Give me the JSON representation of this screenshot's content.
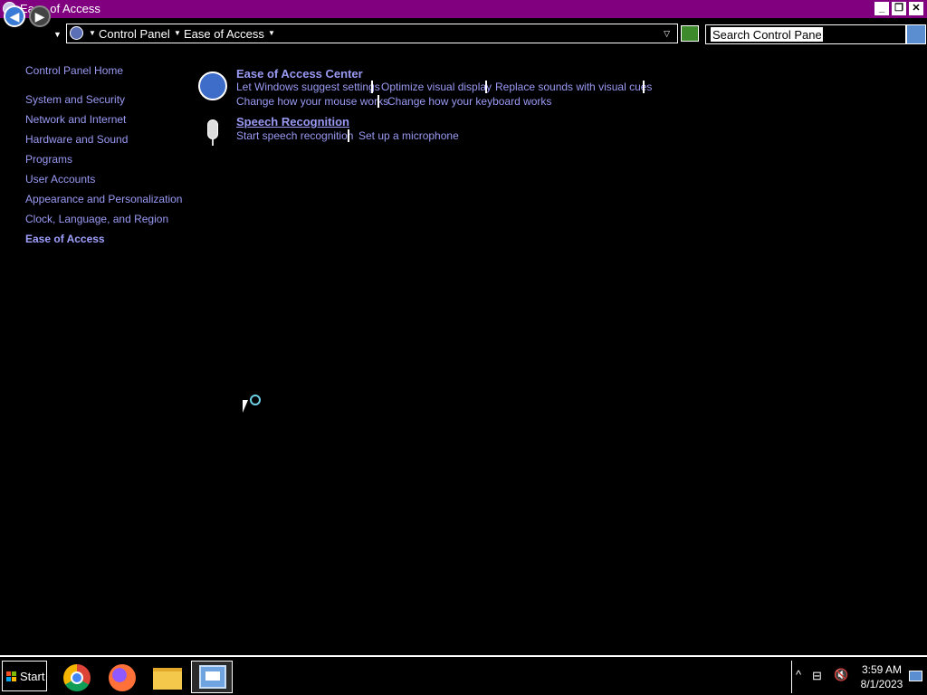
{
  "window": {
    "title": "Ease of Access",
    "controls": {
      "minimize": "_",
      "restore": "❐",
      "close": "✕"
    }
  },
  "address": {
    "crumbs": [
      "Control Panel",
      "Ease of Access"
    ],
    "search_placeholder": "Search Control Panel"
  },
  "sidebar": {
    "home": "Control Panel Home",
    "items": [
      {
        "label": "System and Security"
      },
      {
        "label": "Network and Internet"
      },
      {
        "label": "Hardware and Sound"
      },
      {
        "label": "Programs"
      },
      {
        "label": "User Accounts"
      },
      {
        "label": "Appearance and Personalization"
      },
      {
        "label": "Clock, Language, and Region"
      },
      {
        "label": "Ease of Access"
      }
    ]
  },
  "main": {
    "categories": [
      {
        "title": "Ease of Access Center",
        "icon": "ease-of-access-icon",
        "tasks": [
          "Let Windows suggest settings",
          "Optimize visual display",
          "Replace sounds with visual cues",
          "Change how your mouse works",
          "Change how your keyboard works"
        ]
      },
      {
        "title": "Speech Recognition",
        "icon": "microphone-icon",
        "tasks": [
          "Start speech recognition",
          "Set up a microphone"
        ]
      }
    ]
  },
  "taskbar": {
    "start_label": "Start",
    "apps": [
      "chrome-icon",
      "firefox-icon",
      "file-explorer-icon",
      "control-panel-icon"
    ],
    "clock": {
      "time": "3:59 AM",
      "date": "8/1/2023"
    }
  },
  "colors": {
    "titlebar": "#800080",
    "link": "#9a9af5",
    "background": "#000000"
  }
}
